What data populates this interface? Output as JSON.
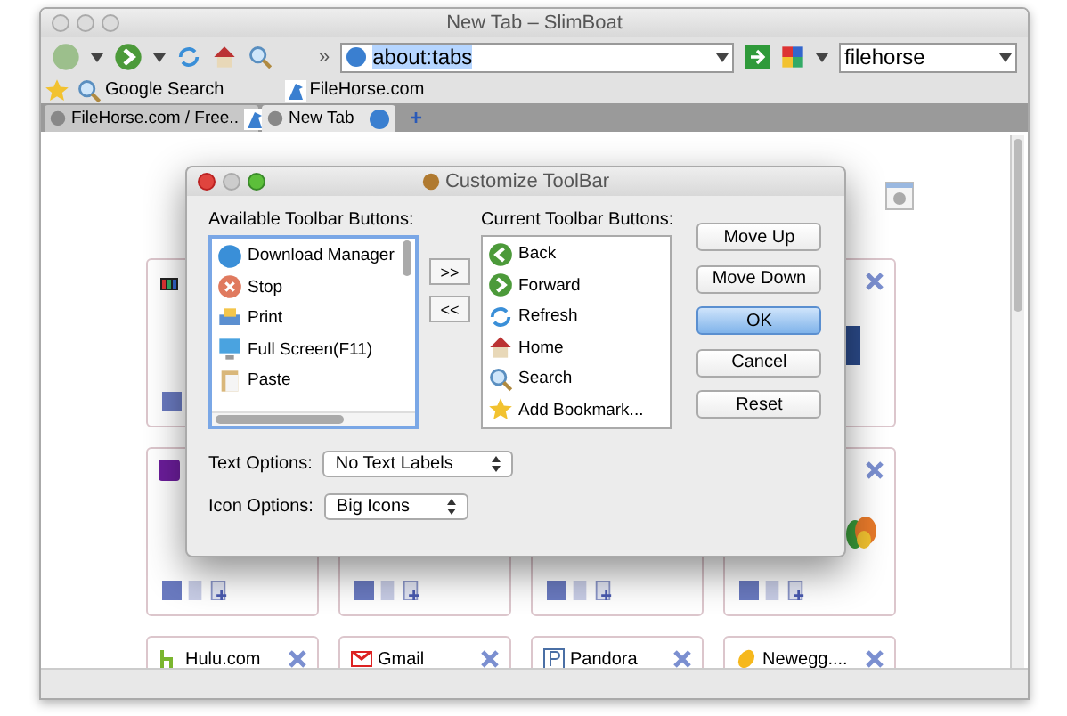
{
  "window": {
    "title": "New Tab – SlimBoat"
  },
  "toolbar": {
    "address": "about:tabs",
    "search": "filehorse",
    "overflow": "»"
  },
  "bookmarks": [
    {
      "label": "Google Search",
      "kind": "search"
    },
    {
      "label": "FileHorse.com",
      "kind": "horse"
    }
  ],
  "new_tab": "+",
  "tabs": [
    {
      "label": "FileHorse.com / Free..",
      "selected": false,
      "kind": "horse"
    },
    {
      "label": "New Tab",
      "selected": true,
      "kind": "globe"
    }
  ],
  "tiles": [
    {
      "kind": "shop"
    },
    {
      "kind": "fb",
      "closable": true
    },
    {
      "kind": "yahoo"
    },
    {
      "kind": "blank"
    },
    {
      "kind": "blank"
    },
    {
      "kind": "msn",
      "closable": true
    },
    {
      "kind": "hulu",
      "title": "Hulu.com",
      "closable": true
    },
    {
      "kind": "gmail",
      "title": "Gmail",
      "closable": true
    },
    {
      "kind": "pandora",
      "title": "Pandora",
      "closable": true
    },
    {
      "kind": "egg",
      "title": "Newegg....",
      "closable": true
    }
  ],
  "dialog": {
    "title": "Customize ToolBar",
    "available_label": "Available Toolbar Buttons:",
    "available": [
      {
        "label": "Download Manager",
        "kind": "download"
      },
      {
        "label": "Stop",
        "kind": "stop"
      },
      {
        "label": "Print",
        "kind": "print"
      },
      {
        "label": "Full Screen(F11)",
        "kind": "screen"
      },
      {
        "label": "Paste",
        "kind": "paste"
      }
    ],
    "move_buttons": [
      ">>",
      "<<"
    ],
    "current_label": "Current Toolbar Buttons:",
    "current": [
      {
        "label": "Back",
        "kind": "back"
      },
      {
        "label": "Forward",
        "kind": "forward"
      },
      {
        "label": "Refresh",
        "kind": "refresh"
      },
      {
        "label": "Home",
        "kind": "home"
      },
      {
        "label": "Search",
        "kind": "search"
      },
      {
        "label": "Add Bookmark...",
        "kind": "star"
      }
    ],
    "buttons": [
      {
        "label": "Move Up",
        "default": false
      },
      {
        "label": "Move Down",
        "default": false
      },
      {
        "label": "OK",
        "default": true
      },
      {
        "label": "Cancel",
        "default": false
      },
      {
        "label": "Reset",
        "default": false
      }
    ],
    "options": [
      {
        "label": "Text Options:",
        "value": "No Text Labels"
      },
      {
        "label": "Icon Options:",
        "value": "Big Icons"
      }
    ]
  }
}
